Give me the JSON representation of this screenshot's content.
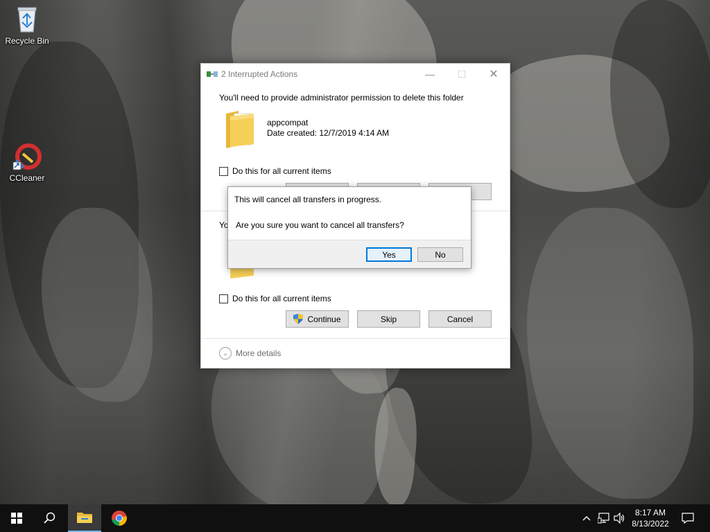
{
  "desktop": {
    "icons": [
      {
        "label": "Recycle Bin"
      },
      {
        "label": "CCleaner"
      }
    ]
  },
  "window": {
    "title": "2 Interrupted Actions",
    "minimize_glyph": "—",
    "maximize_glyph": "☐",
    "close_glyph": "✕",
    "item1": {
      "message": "You'll need to provide administrator permission to delete this folder",
      "file_name": "appcompat",
      "date_created": "Date created: 12/7/2019 4:14 AM",
      "checkbox_label": "Do this for all current items"
    },
    "item2": {
      "message_fragment": "Yo",
      "checkbox_label": "Do this for all current items",
      "continue_label": "Continue",
      "skip_label": "Skip",
      "cancel_label": "Cancel"
    },
    "more_details": "More details"
  },
  "confirm_dialog": {
    "line1": "This will cancel all transfers in progress.",
    "line2": "Are you sure you want to cancel all transfers?",
    "yes_label": "Yes",
    "no_label": "No"
  },
  "taskbar": {
    "time": "8:17 AM",
    "date": "8/13/2022",
    "accent_color": "#76b9ed"
  }
}
